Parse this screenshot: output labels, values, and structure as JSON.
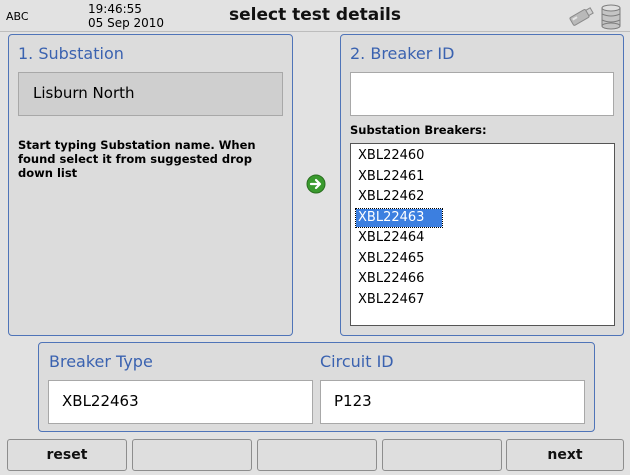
{
  "header": {
    "label": "ABC",
    "time": "19:46:55",
    "date": "05 Sep 2010",
    "title": "select test details"
  },
  "substation": {
    "title": "1. Substation",
    "value": "Lisburn North",
    "help": "Start typing Substation name. When found select it from suggested drop down list"
  },
  "breaker": {
    "title": "2. Breaker ID",
    "input_value": "",
    "list_label": "Substation Breakers:",
    "items": [
      "XBL22460",
      "XBL22461",
      "XBL22462",
      "XBL22463",
      "XBL22464",
      "XBL22465",
      "XBL22466",
      "XBL22467"
    ],
    "selected": "XBL22463"
  },
  "details": {
    "breaker_type_label": "Breaker Type",
    "breaker_type_value": "XBL22463",
    "circuit_id_label": "Circuit ID",
    "circuit_id_value": "P123"
  },
  "footer": {
    "reset_label": "reset",
    "next_label": "next"
  },
  "colors": {
    "accent": "#3a62b0",
    "selection": "#3c7fe0",
    "arrow": "#3a9a2e"
  },
  "icons": [
    "usb-drive-icon",
    "database-icon",
    "arrow-right-icon"
  ]
}
